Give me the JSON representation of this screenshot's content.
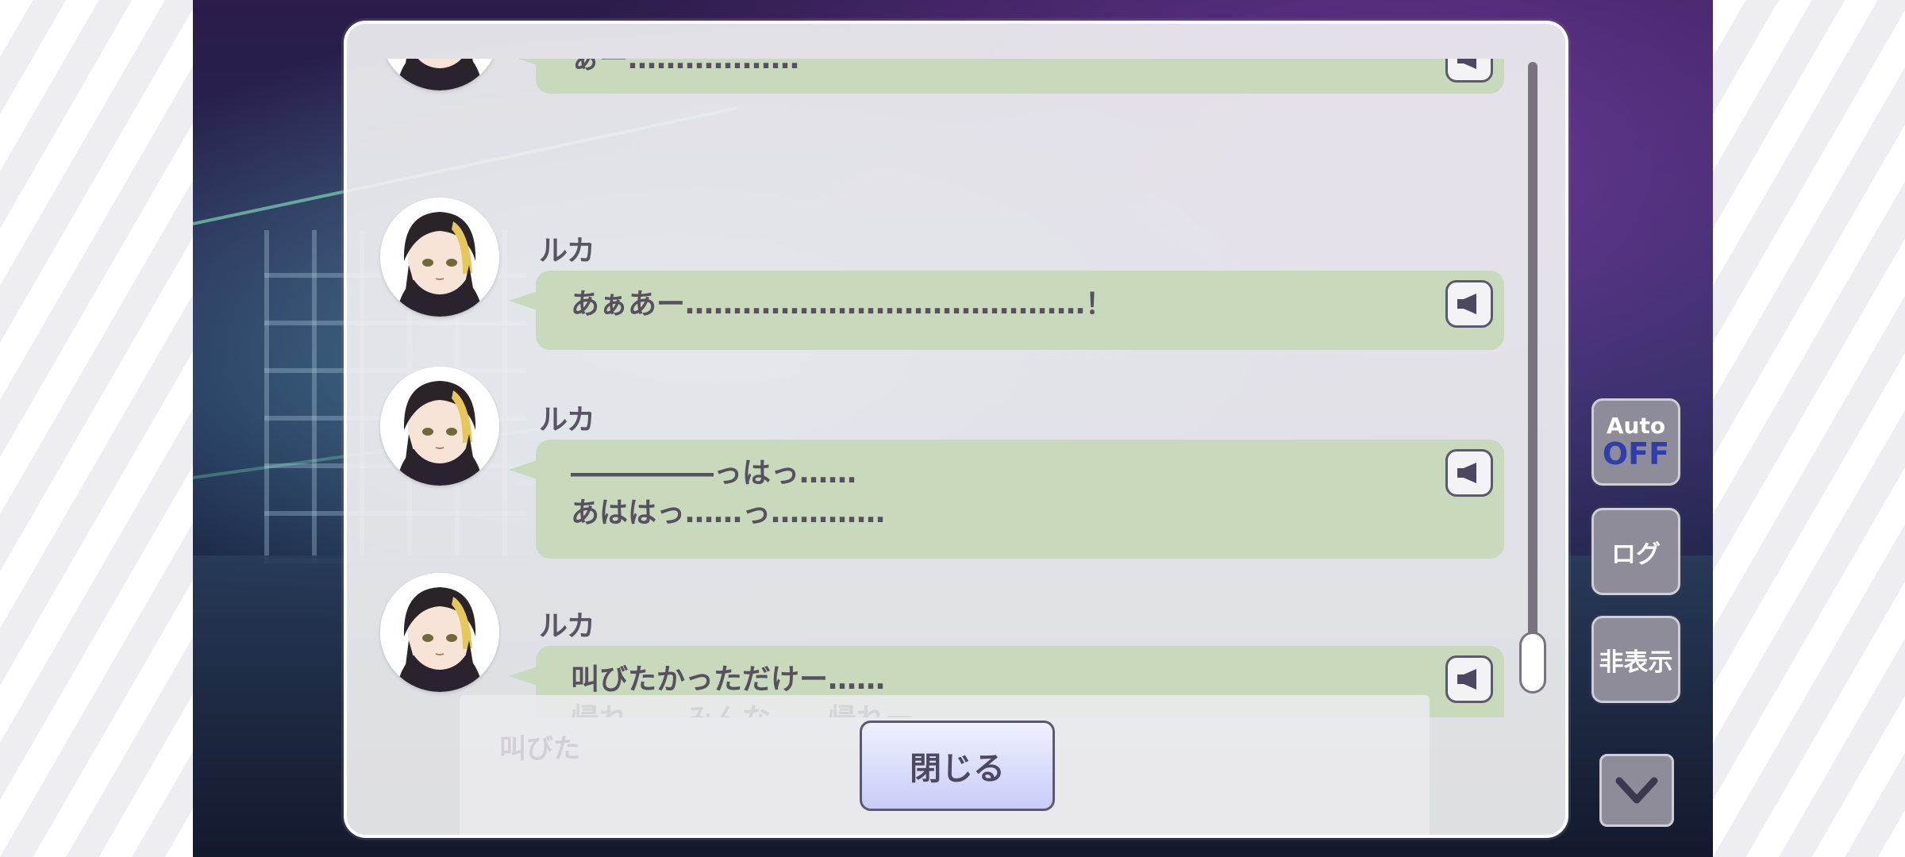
{
  "log": {
    "entries": [
      {
        "speaker": "",
        "text": "ぁー………………"
      },
      {
        "speaker": "ルカ",
        "text": "あぁあー……………………………………！"
      },
      {
        "speaker": "ルカ",
        "text": "―――――っはっ……\nあははっ……っ…………"
      },
      {
        "speaker": "ルカ",
        "text": "叫びたかっただけー……\n帰れ……みんな……帰れー…………"
      }
    ],
    "voice_icon": "speaker-icon",
    "close_label": "閉じる",
    "background_faded_text": "叫びた"
  },
  "controls": {
    "auto_label": "Auto",
    "auto_state": "OFF",
    "log_label": "ログ",
    "hide_label": "非表示",
    "menu_icon": "chevron-down-icon"
  },
  "colors": {
    "bubble": "#c8d9bc",
    "text": "#57515f",
    "accent": "#2f3ea8"
  }
}
